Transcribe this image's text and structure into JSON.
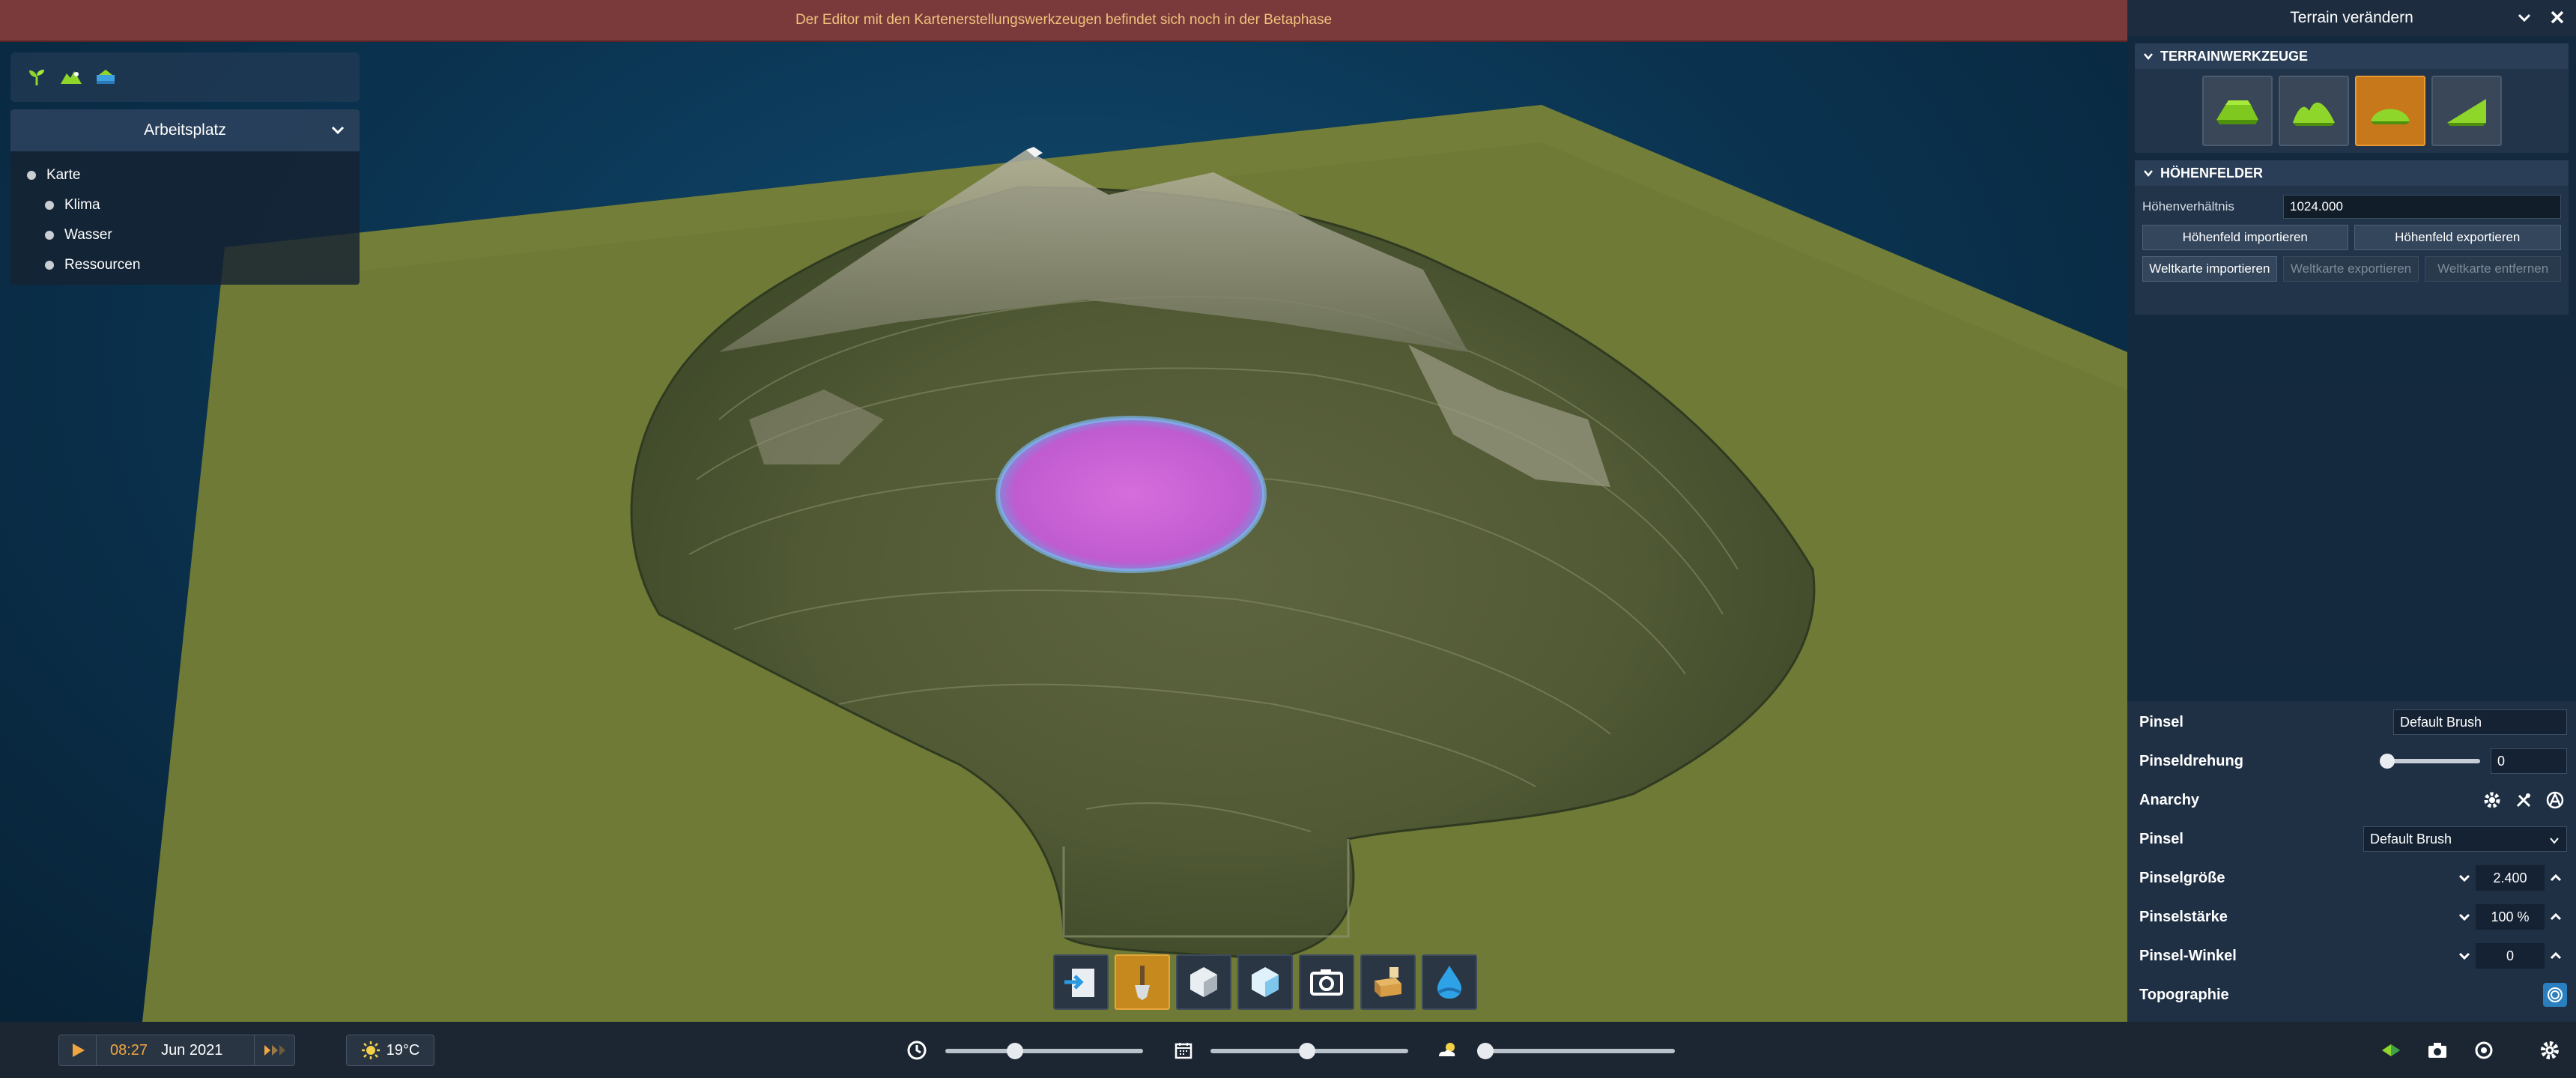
{
  "banner": {
    "text": "Der Editor mit den Kartenerstellungswerkzeugen befindet sich noch in der Betaphase"
  },
  "workspace": {
    "title": "Arbeitsplatz",
    "items": [
      {
        "label": "Karte"
      },
      {
        "label": "Klima"
      },
      {
        "label": "Wasser"
      },
      {
        "label": "Ressourcen"
      }
    ]
  },
  "right_panel": {
    "title": "Terrain verändern",
    "terrain_tools_header": "TERRAINWERKZEUGE",
    "heightfields_header": "HÖHENFELDER",
    "ratio_label": "Höhenverhältnis",
    "ratio_value": "1024.000",
    "import_heightfield": "Höhenfeld importieren",
    "export_heightfield": "Höhenfeld exportieren",
    "import_worldmap": "Weltkarte importieren",
    "export_worldmap": "Weltkarte exportieren",
    "remove_worldmap": "Weltkarte entfernen"
  },
  "brush": {
    "brush_label": "Pinsel",
    "brush_value": "Default Brush",
    "rotation_label": "Pinseldrehung",
    "rotation_value": "0",
    "anarchy_label": "Anarchy",
    "brush2_label": "Pinsel",
    "brush2_value": "Default Brush",
    "size_label": "Pinselgröße",
    "size_value": "2.400",
    "strength_label": "Pinselstärke",
    "strength_value": "100 %",
    "angle_label": "Pinsel-Winkel",
    "angle_value": "0",
    "topography_label": "Topographie"
  },
  "status": {
    "time": "08:27",
    "date": "Jun 2021",
    "temperature": "19°C"
  },
  "colors": {
    "accent": "#c6781a",
    "banner": "#7a3a3c",
    "terrain": "#6f7a37",
    "lake": "#c45fd0"
  }
}
